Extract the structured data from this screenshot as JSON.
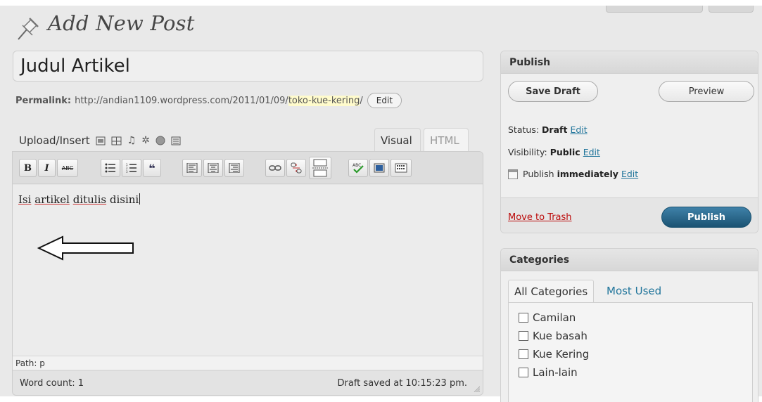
{
  "page": {
    "title": "Add New Post",
    "icon": "pushpin-icon"
  },
  "post": {
    "title_value": "Judul Artikel",
    "permalink_label": "Permalink:",
    "permalink_base": "http://andian1109.wordpress.com/2011/01/09/",
    "permalink_slug": "toko-kue-kering",
    "permalink_suffix": "/",
    "permalink_edit_label": "Edit"
  },
  "editor": {
    "upload_insert_label": "Upload/Insert",
    "media_icons": [
      "image-icon",
      "gallery-icon",
      "audio-icon",
      "media-icon",
      "video-icon",
      "poll-icon"
    ],
    "tabs": {
      "visual": "Visual",
      "html": "HTML"
    },
    "toolbar_bold": "B",
    "toolbar_italic": "I",
    "toolbar_strike": "ABC",
    "toolbar_icons": [
      "bold-icon",
      "italic-icon",
      "strikethrough-icon",
      "bullet-list-icon",
      "numbered-list-icon",
      "blockquote-icon",
      "align-left-icon",
      "align-center-icon",
      "align-right-icon",
      "link-icon",
      "unlink-icon",
      "more-tag-icon",
      "spellcheck-icon",
      "fullscreen-icon",
      "kitchen-sink-icon"
    ],
    "content_words": [
      "Isi",
      "artikel",
      "ditulis",
      "disini"
    ],
    "annotation": "arrow-left-icon",
    "path_text": "Path: p",
    "word_count": "Word count: 1",
    "draft_saved": "Draft saved at 10:15:23 pm."
  },
  "publish": {
    "header": "Publish",
    "save_draft": "Save Draft",
    "preview": "Preview",
    "status_label": "Status:",
    "status_value": "Draft",
    "visibility_label": "Visibility:",
    "visibility_value": "Public",
    "publish_label": "Publish",
    "publish_value": "immediately",
    "edit_label": "Edit",
    "move_to_trash": "Move to Trash",
    "publish_button": "Publish"
  },
  "categories": {
    "header": "Categories",
    "tab_all": "All Categories",
    "tab_most_used": "Most Used",
    "items": [
      "Camilan",
      "Kue basah",
      "Kue Kering",
      "Lain-lain"
    ]
  },
  "colors": {
    "link": "#21759b",
    "trash": "#bc0b0b",
    "publish_btn": "#21759b",
    "slug_highlight": "#fffbcc"
  }
}
